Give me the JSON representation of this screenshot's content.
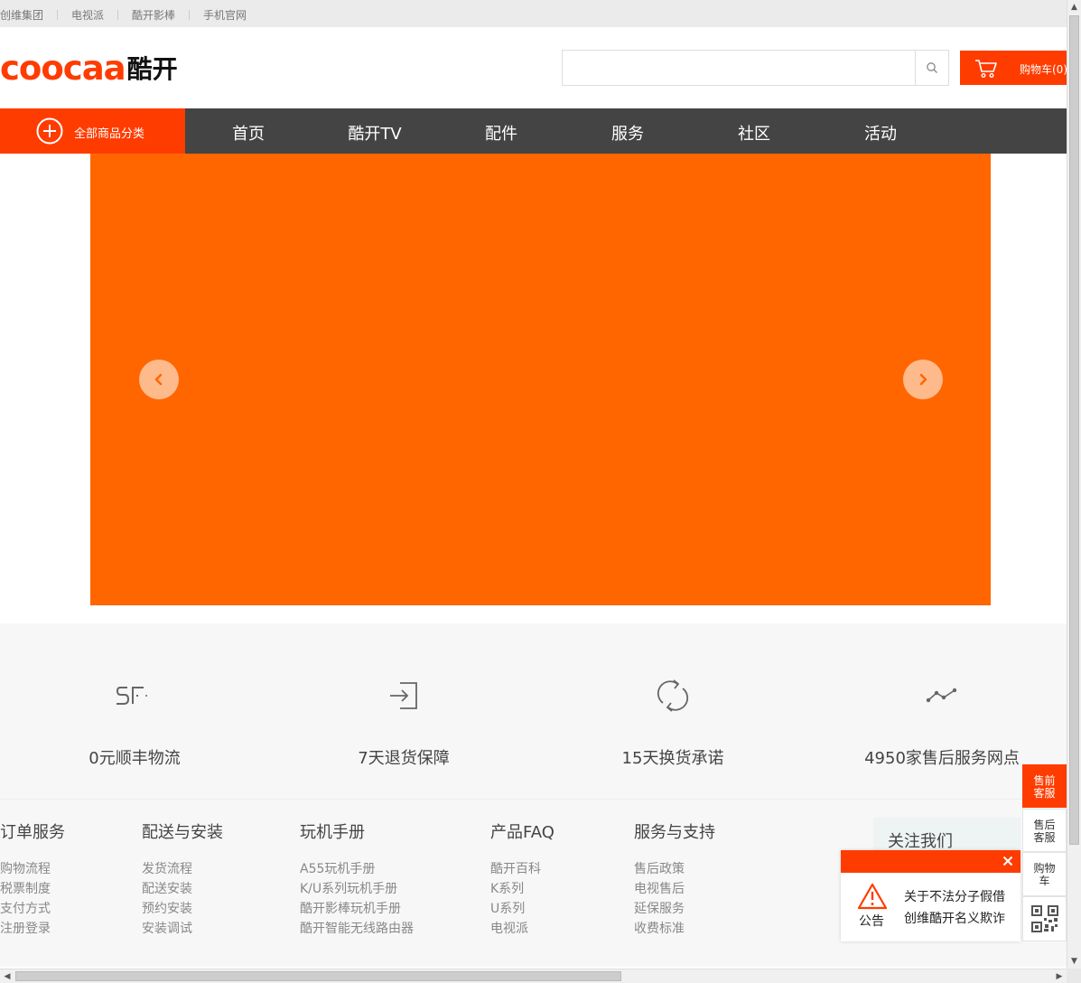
{
  "topbar": {
    "links": [
      "创维集团",
      "电视派",
      "酷开影棒",
      "手机官网"
    ]
  },
  "logo": {
    "latin": "coocaa",
    "cn": "酷开"
  },
  "search": {
    "placeholder": "",
    "value": ""
  },
  "cart": {
    "label": "购物车(0)"
  },
  "nav": {
    "all_categories": "全部商品分类",
    "items": [
      "首页",
      "酷开TV",
      "配件",
      "服务",
      "社区",
      "活动"
    ]
  },
  "banner": {
    "color": "#ff6600"
  },
  "features": [
    {
      "icon": "sf-logo-icon",
      "text": "0元顺丰物流"
    },
    {
      "icon": "return-icon",
      "text": "7天退货保障"
    },
    {
      "icon": "refresh-icon",
      "text": "15天换货承诺"
    },
    {
      "icon": "network-icon",
      "text": "4950家售后服务网点"
    }
  ],
  "footer": {
    "columns": [
      {
        "title": "订单服务",
        "links": [
          "购物流程",
          "税票制度",
          "支付方式",
          "注册登录"
        ]
      },
      {
        "title": "配送与安装",
        "links": [
          "发货流程",
          "配送安装",
          "预约安装",
          "安装调试"
        ]
      },
      {
        "title": "玩机手册",
        "links": [
          "A55玩机手册",
          "K/U系列玩机手册",
          "酷开影棒玩机手册",
          "酷开智能无线路由器"
        ]
      },
      {
        "title": "产品FAQ",
        "links": [
          "酷开百科",
          "K系列",
          "U系列",
          "电视派"
        ]
      },
      {
        "title": "服务与支持",
        "links": [
          "售后政策",
          "电视售后",
          "延保服务",
          "收费标准"
        ]
      }
    ],
    "follow_title": "关注我们"
  },
  "notice": {
    "label": "公告",
    "line1": "关于不法分子假借",
    "line2": "创维酷开名义欺诈"
  },
  "sidebar": {
    "presale": "售前客服",
    "aftersale": "售后客服",
    "cart": "购物车"
  },
  "colors": {
    "brand": "#ff3c00",
    "banner": "#ff6600",
    "nav_bg": "#444444"
  }
}
